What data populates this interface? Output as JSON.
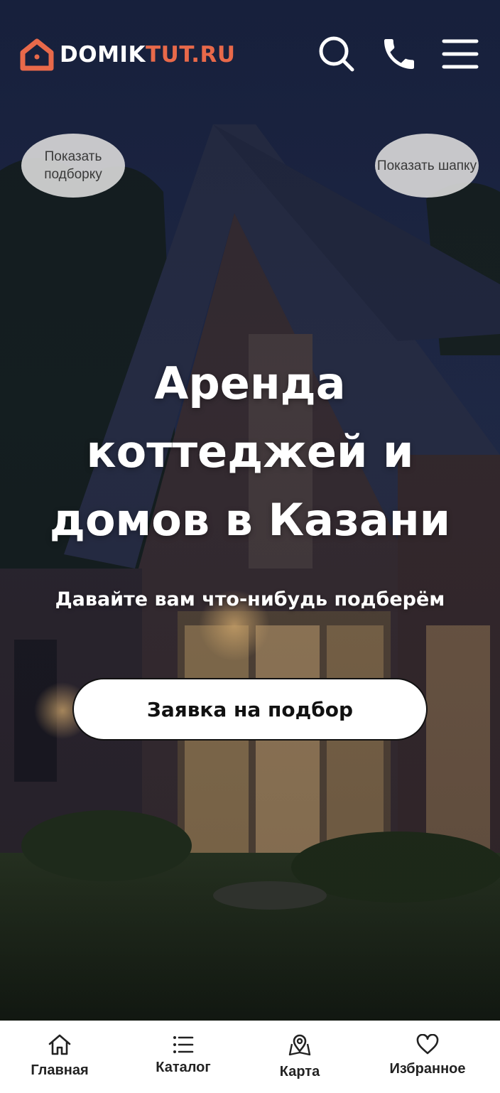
{
  "header": {
    "logo_main": "DOMIK",
    "logo_accent": "TUT",
    "logo_suffix": ".RU",
    "icons": [
      "search-icon",
      "phone-icon",
      "menu-icon"
    ]
  },
  "pills": {
    "left": "Показать подборку",
    "right": "Показать шапку"
  },
  "hero": {
    "title": "Аренда коттеджей и домов в Казани",
    "subtitle": "Давайте вам что-нибудь подберём",
    "cta_label": "Заявка на подбор"
  },
  "bottom_nav": {
    "items": [
      {
        "label": "Главная",
        "icon": "home-icon"
      },
      {
        "label": "Каталог",
        "icon": "list-icon"
      },
      {
        "label": "Карта",
        "icon": "map-pin-icon"
      },
      {
        "label": "Избранное",
        "icon": "heart-icon"
      }
    ]
  },
  "colors": {
    "accent": "#e8694a",
    "nav_background": "#ffffff",
    "pill_background": "#d6d6d6"
  }
}
